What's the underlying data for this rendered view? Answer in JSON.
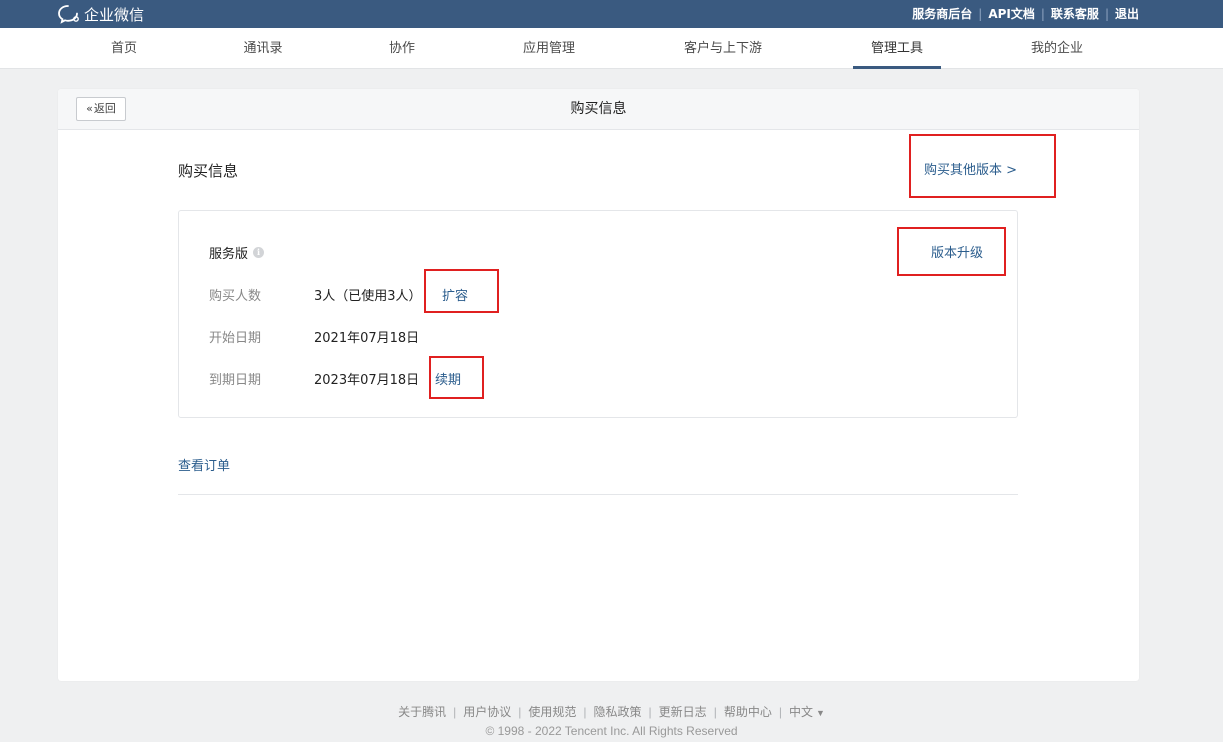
{
  "topbar": {
    "brand": "企业微信",
    "links": [
      "服务商后台",
      "API文档",
      "联系客服",
      "退出"
    ],
    "bg_color": "#3a5a80"
  },
  "nav": {
    "items": [
      "首页",
      "通讯录",
      "协作",
      "应用管理",
      "客户与上下游",
      "管理工具",
      "我的企业"
    ],
    "active": "管理工具"
  },
  "page": {
    "back_label": "返回",
    "title": "购买信息"
  },
  "content": {
    "section_title": "购买信息",
    "buy_other_label": "购买其他版本 >",
    "plan": {
      "name": "服务版",
      "upgrade_label": "版本升级",
      "rows": [
        {
          "label": "购买人数",
          "value": "3人（已使用3人）",
          "action": "扩容"
        },
        {
          "label": "开始日期",
          "value": "2021年07月18日",
          "action": ""
        },
        {
          "label": "到期日期",
          "value": "2023年07月18日",
          "action": "续期"
        }
      ]
    },
    "view_orders_label": "查看订单"
  },
  "footer": {
    "links": [
      "关于腾讯",
      "用户协议",
      "使用规范",
      "隐私政策",
      "更新日志",
      "帮助中心"
    ],
    "language": "中文",
    "copyright": "© 1998 - 2022 Tencent Inc. All Rights Reserved"
  },
  "colors": {
    "link": "#2b5d8d",
    "highlight": "#e02020"
  }
}
